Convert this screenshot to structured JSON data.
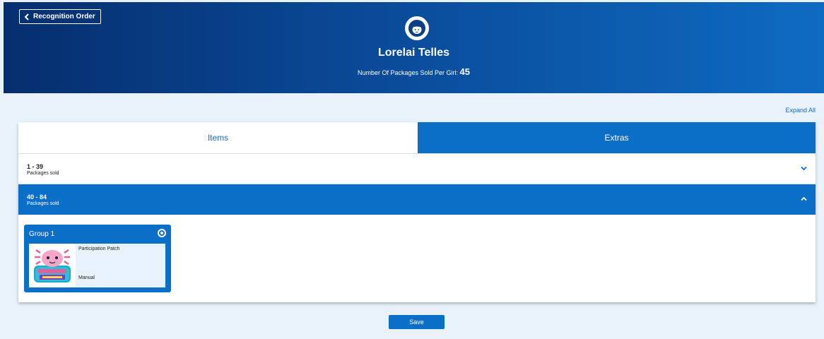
{
  "header": {
    "back_label": "Recognition Order",
    "name": "Lorelai Telles",
    "packages_label": "Number Of Packages Sold Per Girl:",
    "packages_value": "45"
  },
  "expand_all_label": "Expand All",
  "tabs": [
    {
      "label": "Items"
    },
    {
      "label": "Extras"
    }
  ],
  "tiers": [
    {
      "range": "1 - 39",
      "subtitle": "Packages sold",
      "expanded": false
    },
    {
      "range": "40 - 84",
      "subtitle": "Packages sold",
      "expanded": true
    }
  ],
  "group": {
    "title": "Group 1",
    "selected": true,
    "item": {
      "name": "Participation Patch",
      "type": "Manual",
      "thumbnail_icon": "axolotl-patch-icon"
    }
  },
  "save_label": "Save",
  "colors": {
    "primary": "#0b6ec7",
    "header_dark": "#062e6e",
    "page_bg": "#e9f2fb"
  }
}
